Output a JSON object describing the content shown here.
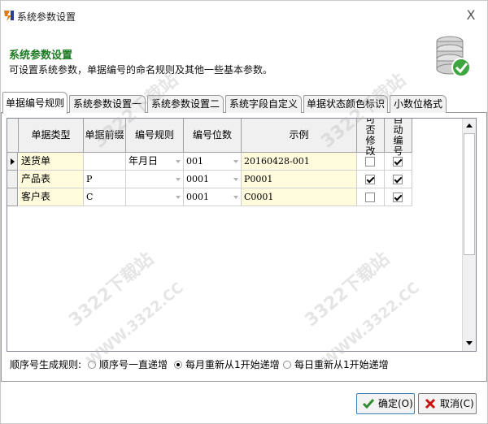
{
  "window": {
    "title": "系统参数设置",
    "close_glyph": "X"
  },
  "header": {
    "title": "系统参数设置",
    "description": "可设置系统参数，单据编号的命名规则及其他一些基本参数。"
  },
  "tabs": [
    {
      "label": "单据编号规则",
      "active": true
    },
    {
      "label": "系统参数设置一",
      "active": false
    },
    {
      "label": "系统参数设置二",
      "active": false
    },
    {
      "label": "系统字段自定义",
      "active": false
    },
    {
      "label": "单据状态颜色标识",
      "active": false
    },
    {
      "label": "小数位格式",
      "active": false
    }
  ],
  "grid": {
    "columns": [
      "单据类型",
      "单据前缀",
      "编号规则",
      "编号位数",
      "示例",
      "可否修改",
      "自动编号"
    ],
    "rows": [
      {
        "type": "送货单",
        "prefix": "",
        "rule": "年月日",
        "digits": "001",
        "example": "20160428-001",
        "modifiable": false,
        "auto": true,
        "current": true
      },
      {
        "type": "产品表",
        "prefix": "P",
        "rule": "",
        "digits": "0001",
        "example": "P0001",
        "modifiable": true,
        "auto": true,
        "current": false
      },
      {
        "type": "客户表",
        "prefix": "C",
        "rule": "",
        "digits": "0001",
        "example": "C0001",
        "modifiable": false,
        "auto": true,
        "current": false
      }
    ]
  },
  "sequence": {
    "label": "顺序号生成规则:",
    "options": [
      {
        "label": "顺序号一直递增",
        "checked": false
      },
      {
        "label": "每月重新从1开始递增",
        "checked": true
      },
      {
        "label": "每日重新从1开始递增",
        "checked": false
      }
    ]
  },
  "buttons": {
    "ok_label": "确定(O)",
    "cancel_label": "取消(C)"
  },
  "watermark": {
    "text_a": "3322下载站",
    "text_b": "WWW.3322.CC"
  },
  "colors": {
    "header_title": "#1a7a20",
    "cell_highlight": "#fffbdc",
    "ok_icon": "#2e8b2e",
    "cancel_icon": "#cc1111"
  }
}
